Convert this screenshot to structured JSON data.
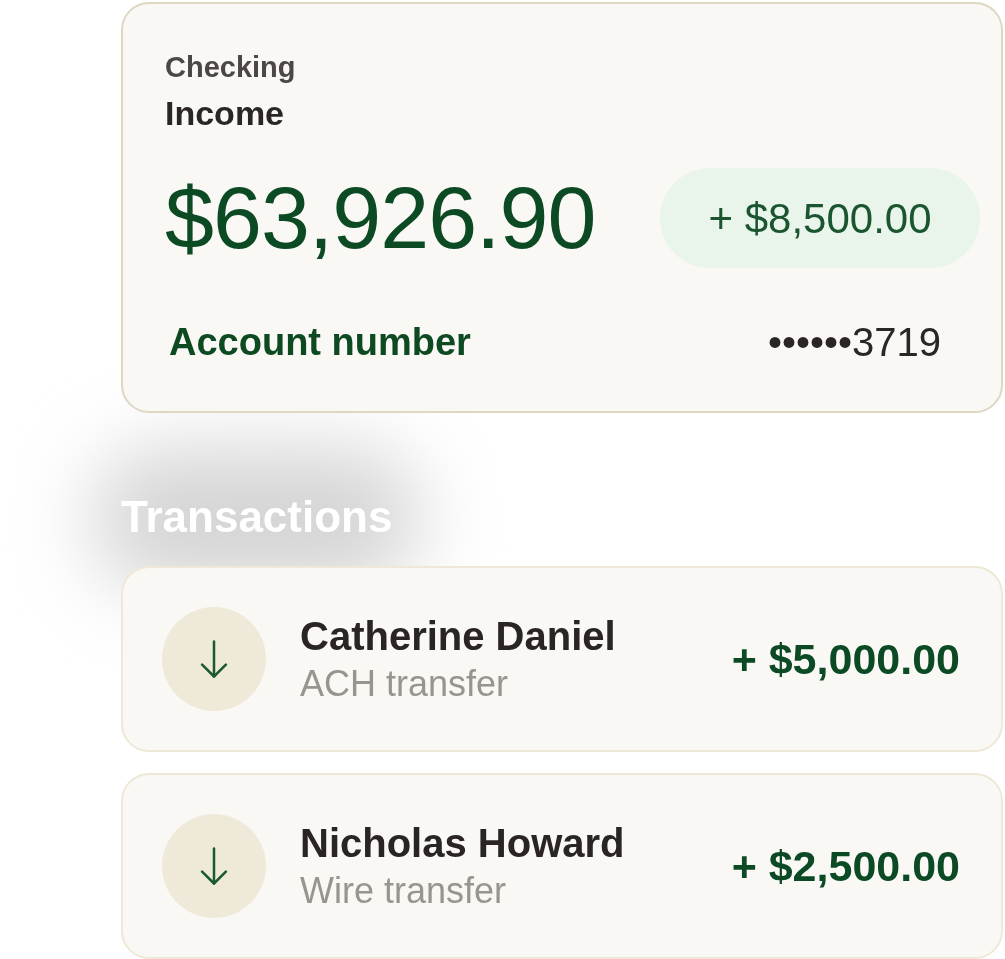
{
  "account_card": {
    "type_label": "Checking",
    "title": "Income",
    "balance": "$63,926.90",
    "change_badge": "+ $8,500.00",
    "account_number_label": "Account number",
    "account_number": "••••••3719"
  },
  "transactions_heading": "Transactions",
  "transactions": [
    {
      "kind": "incoming",
      "name": "Catherine Daniel",
      "method": "ACH transfer",
      "amount": "+ $5,000.00"
    },
    {
      "kind": "incoming",
      "name": "Nicholas Howard",
      "method": "Wire transfer",
      "amount": "+ $2,500.00"
    }
  ]
}
